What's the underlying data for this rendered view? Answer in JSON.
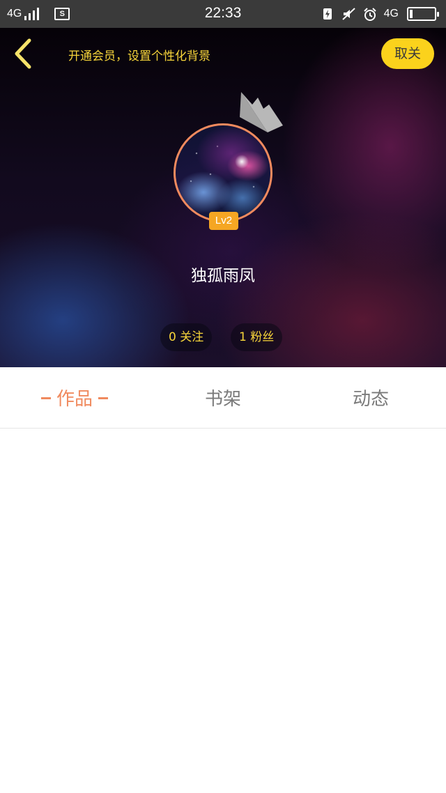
{
  "status_bar": {
    "network_left": "4G",
    "time": "22:33",
    "network_right": "4G",
    "sim_icon_label": "S",
    "icons": [
      "signal-bars-icon",
      "sim-card-icon",
      "charging-icon",
      "mute-icon",
      "alarm-icon",
      "battery-icon"
    ]
  },
  "header": {
    "promo_text": "开通会员，设置个性化背景",
    "unfollow_label": "取关",
    "back_icon": "chevron-left-icon"
  },
  "profile": {
    "level_badge": "Lv2",
    "username": "独孤雨凤",
    "follow_stat": "0 关注",
    "fans_stat": "1 粉丝"
  },
  "tabs": {
    "items": [
      {
        "label": "作品",
        "active": true
      },
      {
        "label": "书架",
        "active": false
      },
      {
        "label": "动态",
        "active": false
      }
    ]
  },
  "colors": {
    "accent_orange": "#f08a5e",
    "accent_yellow": "#fbd21c",
    "promo_yellow": "#f7d53a",
    "tab_inactive": "#7a7a7a",
    "status_bar_bg": "#3a3a3a",
    "level_badge_bg": "#f5a623"
  }
}
